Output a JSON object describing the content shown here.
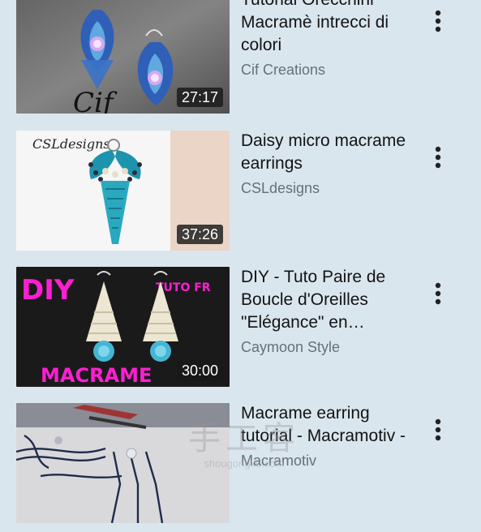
{
  "feed": {
    "videos": [
      {
        "title": "Tutorial Orecchini Macramè intrecci di colori",
        "channel": "Cif Creations",
        "duration": "27:17",
        "thumbnail_text": "Cif"
      },
      {
        "title": "Daisy micro macrame earrings",
        "channel": "CSLdesigns",
        "duration": "37:26",
        "thumbnail_text": "CSLdesigns"
      },
      {
        "title": "DIY - Tuto Paire de Boucle d'Oreilles \"Elégance\" en…",
        "channel": "Caymoon Style",
        "duration": "30:00",
        "thumbnail_text": "DIY",
        "thumbnail_text_2": "TUTO FR",
        "thumbnail_text_3": "MACRAME"
      },
      {
        "title": "Macrame earring tutorial - Macramotiv - ",
        "channel": "Macramotiv",
        "duration": "",
        "thumbnail_text": ""
      }
    ],
    "menu_icon": "more-vert-icon"
  },
  "watermark": {
    "glyphs": "手工客",
    "url": "shougongke.com"
  },
  "colors": {
    "background": "#dae6ee",
    "title": "#131313",
    "channel": "#65707a",
    "duration_bg": "#191919",
    "thumb_magenta": "#ff1fd2"
  }
}
